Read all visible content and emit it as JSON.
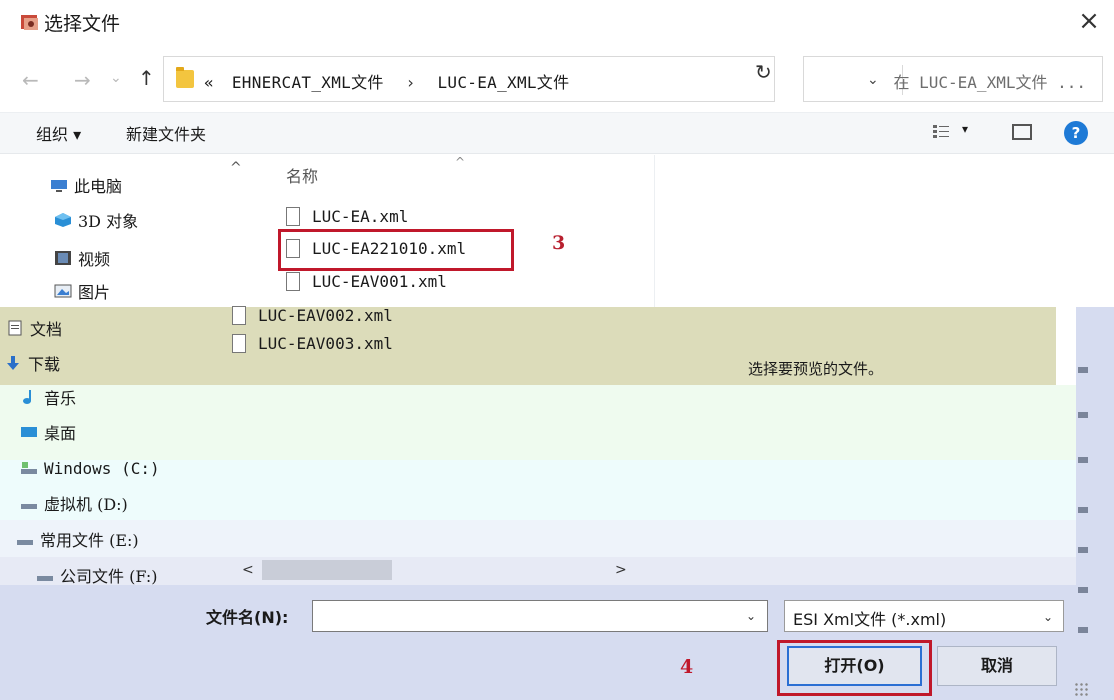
{
  "window": {
    "title": "选择文件",
    "close_glyph": "×"
  },
  "address": {
    "back_glyph": "←",
    "forward_glyph": "→",
    "recent_glyph": "⌄",
    "up_glyph": "↑",
    "crumb_prefix": "«",
    "crumbs": [
      "EHNERCAT_XML文件",
      "LUC-EA_XML文件"
    ],
    "crumb_separator": "›",
    "dropdown_glyph": "⌄",
    "refresh_glyph": "↻"
  },
  "search": {
    "placeholder": "在 LUC-EA_XML文件 ..."
  },
  "toolbar": {
    "organize_label": "组织 ▾",
    "new_folder_label": "新建文件夹",
    "view_dropdown_glyph": "▾",
    "help_glyph": "?"
  },
  "nav": {
    "scroll_up_glyph": "^",
    "items": [
      {
        "label": "此电脑",
        "icon": "pc-icon"
      },
      {
        "label": "3D 对象",
        "icon": "3d-objects-icon"
      },
      {
        "label": "视频",
        "icon": "video-icon"
      },
      {
        "label": "图片",
        "icon": "pictures-icon"
      },
      {
        "label": "文档",
        "icon": "documents-icon"
      },
      {
        "label": "下载",
        "icon": "download-icon"
      },
      {
        "label": "音乐",
        "icon": "music-icon"
      },
      {
        "label": "桌面",
        "icon": "desktop-icon"
      },
      {
        "label": "Windows (C:)",
        "icon": "drive-icon"
      },
      {
        "label": "虚拟机 (D:)",
        "icon": "drive-icon"
      },
      {
        "label": "常用文件 (E:)",
        "icon": "drive-icon"
      },
      {
        "label": "公司文件 (F:)",
        "icon": "drive-icon"
      }
    ]
  },
  "filelist": {
    "column_name": "名称",
    "sort_glyph": "^",
    "files": [
      "LUC-EA.xml",
      "LUC-EA221010.xml",
      "LUC-EAV001.xml",
      "LUC-EAV002.xml",
      "LUC-EAV003.xml"
    ]
  },
  "preview": {
    "empty_text": "选择要预览的文件。"
  },
  "scrollbar": {
    "left_glyph": "<",
    "right_glyph": ">"
  },
  "bottom": {
    "filename_label": "文件名(N):",
    "filename_value": "",
    "filename_dropdown_glyph": "⌄",
    "filter_value": "ESI Xml文件 (*.xml)",
    "filter_dropdown_glyph": "⌄",
    "open_label": "打开(O)",
    "cancel_label": "取消"
  },
  "annotations": {
    "step3": "3",
    "step4": "4",
    "highlight_color": "#c0182b"
  },
  "colors": {
    "accent": "#1e7ad6",
    "folder": "#f3c53f",
    "button_border": "#2b6fd3"
  }
}
